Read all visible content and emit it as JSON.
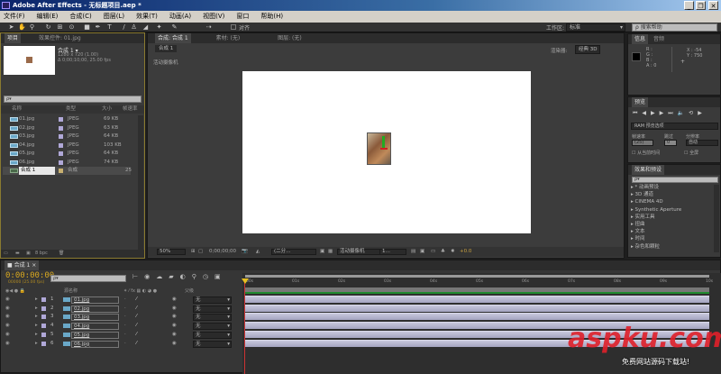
{
  "title": "Adobe After Effects - 无标题项目.aep *",
  "window_controls": {
    "minimize": "_",
    "restore": "❐",
    "close": "✕"
  },
  "menu": [
    "文件(F)",
    "编辑(E)",
    "合成(C)",
    "图层(L)",
    "效果(T)",
    "动画(A)",
    "视图(V)",
    "窗口",
    "帮助(H)"
  ],
  "toolbar": {
    "align_label": "对齐",
    "workspace_label": "工作区:",
    "workspace_value": "标准",
    "search_placeholder": "搜索帮助"
  },
  "project": {
    "tab": "项目",
    "tab2": "效果控件: 01.jpg",
    "comp_name": "合成 1 ▾",
    "comp_res": "1280 x 720 (1.00)",
    "comp_dur": "Δ 0;00;10;00, 25.00 fps",
    "search": "ρ▾",
    "columns": [
      "名称",
      "类型",
      "大小",
      "帧速率"
    ],
    "items": [
      {
        "name": "01.jpg",
        "type": "JPEG",
        "size": "69 KB",
        "fps": ""
      },
      {
        "name": "02.jpg",
        "type": "JPEG",
        "size": "63 KB",
        "fps": ""
      },
      {
        "name": "03.jpg",
        "type": "JPEG",
        "size": "64 KB",
        "fps": ""
      },
      {
        "name": "04.jpg",
        "type": "JPEG",
        "size": "103 KB",
        "fps": ""
      },
      {
        "name": "05.jpg",
        "type": "JPEG",
        "size": "64 KB",
        "fps": ""
      },
      {
        "name": "06.jpg",
        "type": "JPEG",
        "size": "74 KB",
        "fps": ""
      },
      {
        "name": "合成 1",
        "type": "合成",
        "size": "",
        "fps": "25"
      }
    ],
    "bpc": "8 bpc"
  },
  "comp": {
    "tab": "合成: 合成 1",
    "footage_tab": "素材: (无)",
    "layer_tab": "图层: (无)",
    "subtab": "合成 1",
    "camera_label": "活动摄像机",
    "renderer_label": "渲染器:",
    "renderer_value": "经典 3D",
    "zoom": "50%",
    "timecode": "0;00;00;00",
    "resolution": "(二分…",
    "view": "活动摄像机",
    "views": "1…",
    "exposure": "+0.0"
  },
  "info": {
    "tab": "信息",
    "tab2": "音频",
    "r": "R :",
    "g": "G :",
    "b": "B :",
    "a": "A : 0",
    "x": "X : -54",
    "y": "Y : 750"
  },
  "preview": {
    "tab": "预览",
    "ram": "RAM 预览选项",
    "fps_label": "帧速率",
    "skip_label": "跳过",
    "res_label": "分辨率",
    "fps_value": "(25)",
    "skip_value": "0",
    "res_value": "自动",
    "from_current": "从当前时间",
    "fullscreen": "全屏"
  },
  "effects": {
    "tab": "效果和预设",
    "search": "ρ▾",
    "items": [
      "* 动画预设",
      "3D 通道",
      "CINEMA 4D",
      "Synthetic Aperture",
      "实用工具",
      "扭曲",
      "文本",
      "时间",
      "杂色和颗粒"
    ]
  },
  "timeline": {
    "tab": "合成 1",
    "timecode": "0:00:00:00",
    "timecode_sub": "00000 (25.00 fps)",
    "search": "ρ▾",
    "col_source": "源名称",
    "col_parent": "父级",
    "parent_value": "无",
    "ruler": [
      "00s",
      "01s",
      "02s",
      "03s",
      "04s",
      "05s",
      "06s",
      "07s",
      "08s",
      "09s",
      "10s"
    ],
    "layers": [
      {
        "num": "1",
        "name": "01.jpg"
      },
      {
        "num": "2",
        "name": "02.jpg"
      },
      {
        "num": "3",
        "name": "03.jpg"
      },
      {
        "num": "4",
        "name": "04.jpg"
      },
      {
        "num": "5",
        "name": "05.jpg"
      },
      {
        "num": "6",
        "name": "06.jpg"
      }
    ]
  },
  "watermark": {
    "brand": "aspku.com",
    "sub": "免费网站源码下载站!"
  }
}
